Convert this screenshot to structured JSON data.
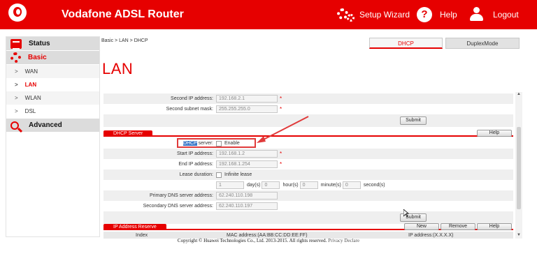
{
  "header": {
    "title": "Vodafone ADSL Router",
    "setup_wizard": "Setup Wizard",
    "help": "Help",
    "logout": "Logout"
  },
  "sidebar": {
    "status": "Status",
    "basic": "Basic",
    "items": [
      {
        "label": "WAN"
      },
      {
        "label": "LAN"
      },
      {
        "label": "WLAN"
      },
      {
        "label": "DSL"
      }
    ],
    "advanced": "Advanced",
    "arrow": ">"
  },
  "main": {
    "breadcrumb": "Basic > LAN > DHCP",
    "tabs": [
      "DHCP",
      "DuplexMode"
    ],
    "title": "LAN"
  },
  "lan_form": {
    "second_ip_label": "Second IP address:",
    "second_ip_value": "192.168.2.1",
    "second_mask_label": "Second subnet mask:",
    "second_mask_value": "255.255.255.0",
    "submit": "Submit"
  },
  "dhcp": {
    "section_title": "DHCP Server",
    "help": "Help",
    "server_label_highlight": "DHCP",
    "server_label_rest": " server:",
    "enable_label": "Enable",
    "start_ip_label": "Start IP address:",
    "start_ip_value": "192.168.1.2",
    "end_ip_label": "End IP address:",
    "end_ip_value": "192.168.1.254",
    "lease_label": "Lease duration:",
    "infinite_lease": "Infinite lease",
    "lease_days": "1",
    "days_label": "day(s)",
    "lease_hours": "0",
    "hours_label": "hour(s)",
    "lease_minutes": "0",
    "minutes_label": "minute(s)",
    "lease_seconds": "0",
    "seconds_label": "second(s)",
    "primary_dns_label": "Primary DNS server address:",
    "primary_dns_value": "62.240.110.198",
    "secondary_dns_label": "Secondary DNS server address:",
    "secondary_dns_value": "62.240.110.197",
    "submit": "Submit",
    "star": "*"
  },
  "reserve": {
    "section_title": "IP Address Reserve",
    "new": "New",
    "remove": "Remove",
    "help": "Help",
    "columns": [
      "Index",
      "MAC address:(AA:BB:CC:DD:EE:FF)",
      "IP address:(X.X.X.X)"
    ]
  },
  "footer": {
    "copyright": "Copyright © Huawei Technologies Co., Ltd. 2013-2015. All rights reserved.",
    "privacy": "Privacy Declare"
  },
  "colors": {
    "brand": "#e60000",
    "annotation": "#e03a3a"
  }
}
